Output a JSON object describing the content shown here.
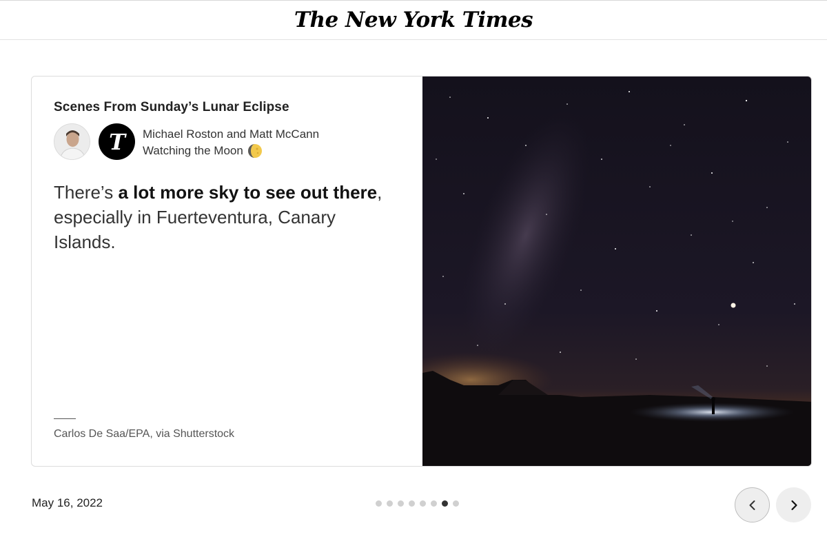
{
  "header": {
    "masthead": "The New York Times"
  },
  "story": {
    "title": "Scenes From Sunday’s Lunar Eclipse",
    "authors": "Michael Roston and Matt McCann",
    "subtitle": "Watching the Moon",
    "body_lead": "There’s ",
    "body_bold": "a lot more sky to see out there",
    "body_rest": ", especially in Fuerteventura, Canary Islands.",
    "credit": "Carlos De Saa/EPA, via Shutterstock"
  },
  "footer": {
    "date": "May 16, 2022",
    "pagination": {
      "total": 8,
      "active_index": 6
    }
  },
  "icons": {
    "logo": "nyt-t-logo-icon",
    "moon": "moon-emoji-icon",
    "prev": "chevron-left-icon",
    "next": "chevron-right-icon"
  }
}
